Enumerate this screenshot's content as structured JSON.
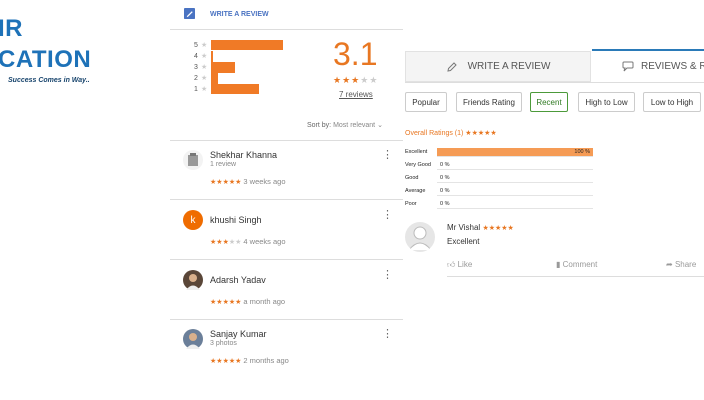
{
  "logo": {
    "line1": "IR",
    "line2": "CATION",
    "tagline": "Success Comes in Way.."
  },
  "left_panel": {
    "write_review": "WRITE A REVIEW",
    "histogram": [
      {
        "star": "5",
        "fraction": 1.0
      },
      {
        "star": "4",
        "fraction": 0.0
      },
      {
        "star": "3",
        "fraction": 0.33
      },
      {
        "star": "2",
        "fraction": 0.0
      },
      {
        "star": "1",
        "fraction": 0.67
      }
    ],
    "rating": "3.1",
    "rating_stars": 3,
    "review_count": "7 reviews",
    "sort_label": "Sort by:",
    "sort_value": "Most relevant",
    "reviews": [
      {
        "name": "Shekhar Khanna",
        "sub": "1 review",
        "stars": 5,
        "when": "3 weeks ago",
        "avatar": "icon"
      },
      {
        "name": "khushi Singh",
        "sub": "",
        "stars": 3,
        "when": "4 weeks ago",
        "avatar": "k"
      },
      {
        "name": "Adarsh Yadav",
        "sub": "",
        "stars": 5,
        "when": "a month ago",
        "avatar": "photo"
      },
      {
        "name": "Sanjay Kumar",
        "sub": "3 photos",
        "stars": 5,
        "when": "2 months ago",
        "avatar": "photo"
      }
    ]
  },
  "right_panel": {
    "tabs": [
      "WRITE A REVIEW",
      "REVIEWS & R"
    ],
    "filters": [
      "Popular",
      "Friends Rating",
      "Recent",
      "High to Low",
      "Low to High"
    ],
    "active_filter": "Recent",
    "overall": "Overall Ratings (1) ★★★★★",
    "breakdown": [
      {
        "label": "Excellent",
        "pct": "100 %",
        "value": 1.0
      },
      {
        "label": "Very Good",
        "pct": "0 %",
        "value": 0
      },
      {
        "label": "Good",
        "pct": "0 %",
        "value": 0
      },
      {
        "label": "Average",
        "pct": "0 %",
        "value": 0
      },
      {
        "label": "Poor",
        "pct": "0 %",
        "value": 0
      }
    ],
    "review": {
      "user": "Mr Vishal",
      "stars": "★★★★★",
      "text": "Excellent"
    },
    "actions": {
      "like": "Like",
      "comment": "Comment",
      "share": "Share"
    }
  },
  "colors": {
    "accent": "#e87722",
    "brand_blue": "#1e72b8",
    "link_blue": "#4a73c2",
    "active_green": "#4c9a3a"
  }
}
